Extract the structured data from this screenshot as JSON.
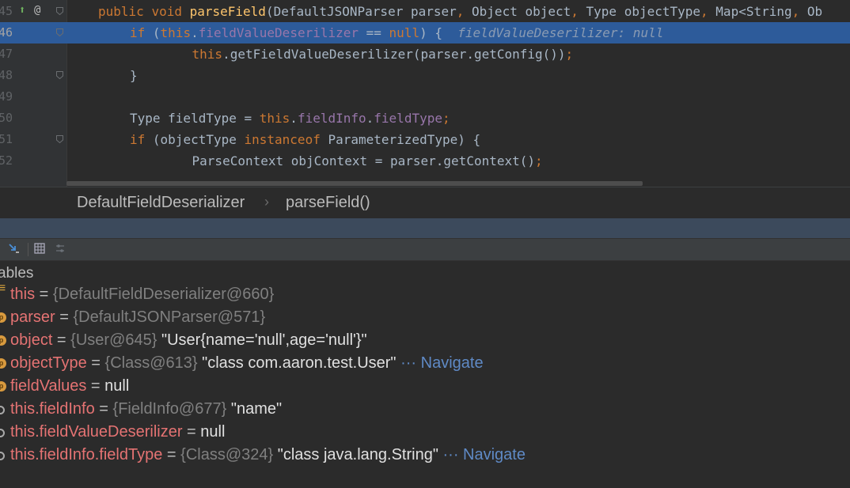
{
  "editor": {
    "lines": [
      {
        "num": "45",
        "tokens": [
          [
            "kw",
            "public "
          ],
          [
            "kw",
            "void "
          ],
          [
            "mth",
            "parseField"
          ],
          [
            "",
            "(DefaultJSONParser parser"
          ],
          [
            "kw",
            ", "
          ],
          [
            "",
            "Object object"
          ],
          [
            "kw",
            ", "
          ],
          [
            "",
            "Type objectType"
          ],
          [
            "kw",
            ", "
          ],
          [
            "",
            "Map<String"
          ],
          [
            "kw",
            ", "
          ],
          [
            "",
            "Ob"
          ]
        ]
      },
      {
        "num": "46",
        "highlight": true,
        "tokens": [
          [
            "kw",
            "if "
          ],
          [
            "",
            "("
          ],
          [
            "kw",
            "this"
          ],
          [
            "",
            "."
          ],
          [
            "fld",
            "fieldValueDeserilizer"
          ],
          [
            "",
            " == "
          ],
          [
            "kw",
            "null"
          ],
          [
            "",
            ") {  "
          ],
          [
            "hint",
            "fieldValueDeserilizer: null"
          ]
        ]
      },
      {
        "num": "47",
        "tokens": [
          [
            "kw",
            "    this"
          ],
          [
            "",
            "."
          ],
          [
            "",
            "getFieldValueDeserilizer(parser.getConfig())"
          ],
          [
            "kw",
            ";"
          ]
        ]
      },
      {
        "num": "48",
        "tokens": [
          [
            "",
            "}"
          ]
        ]
      },
      {
        "num": "49",
        "tokens": []
      },
      {
        "num": "50",
        "tokens": [
          [
            "",
            "Type fieldType = "
          ],
          [
            "kw",
            "this"
          ],
          [
            "",
            "."
          ],
          [
            "fld",
            "fieldInfo"
          ],
          [
            "",
            "."
          ],
          [
            "fld",
            "fieldType"
          ],
          [
            "kw",
            ";"
          ]
        ]
      },
      {
        "num": "51",
        "tokens": [
          [
            "kw",
            "if "
          ],
          [
            "",
            "(objectType "
          ],
          [
            "kw",
            "instanceof "
          ],
          [
            "",
            "ParameterizedType) {"
          ]
        ]
      },
      {
        "num": "52",
        "tokens": [
          [
            "",
            "    ParseContext objContext = parser.getContext()"
          ],
          [
            "kw",
            ";"
          ]
        ]
      }
    ]
  },
  "breadcrumb": {
    "class_name": "DefaultFieldDeserializer",
    "method_name": "parseField()"
  },
  "variables": {
    "title": "ables",
    "rows": [
      {
        "icon": "field-static-icon",
        "name": "this",
        "ref": "{DefaultFieldDeserializer@660}",
        "value": "",
        "navigate": ""
      },
      {
        "icon": "parameter-icon",
        "name": "parser",
        "ref": "{DefaultJSONParser@571}",
        "value": "",
        "navigate": ""
      },
      {
        "icon": "parameter-icon",
        "name": "object",
        "ref": "{User@645}",
        "value": "\"User{name='null',age='null'}\"",
        "navigate": ""
      },
      {
        "icon": "parameter-icon",
        "name": "objectType",
        "ref": "{Class@613}",
        "value": "\"class com.aaron.test.User\"",
        "navigate": "··· Navigate"
      },
      {
        "icon": "parameter-icon",
        "name": "fieldValues",
        "ref": "",
        "value": "null",
        "navigate": ""
      },
      {
        "icon": "watch-icon",
        "name": "this.fieldInfo",
        "ref": "{FieldInfo@677}",
        "value": "\"name\"",
        "navigate": ""
      },
      {
        "icon": "watch-icon",
        "name": "this.fieldValueDeserilizer",
        "ref": "",
        "value": "null",
        "navigate": ""
      },
      {
        "icon": "watch-icon",
        "name": "this.fieldInfo.fieldType",
        "ref": "{Class@324}",
        "value": "\"class java.lang.String\"",
        "navigate": "··· Navigate"
      }
    ]
  },
  "colors": {
    "highlight": "#2d5b9a",
    "keyword": "#cc7832",
    "method": "#ffc66d",
    "field": "#9876aa",
    "var_name": "#e57373",
    "navigate": "#5f8ac6"
  }
}
